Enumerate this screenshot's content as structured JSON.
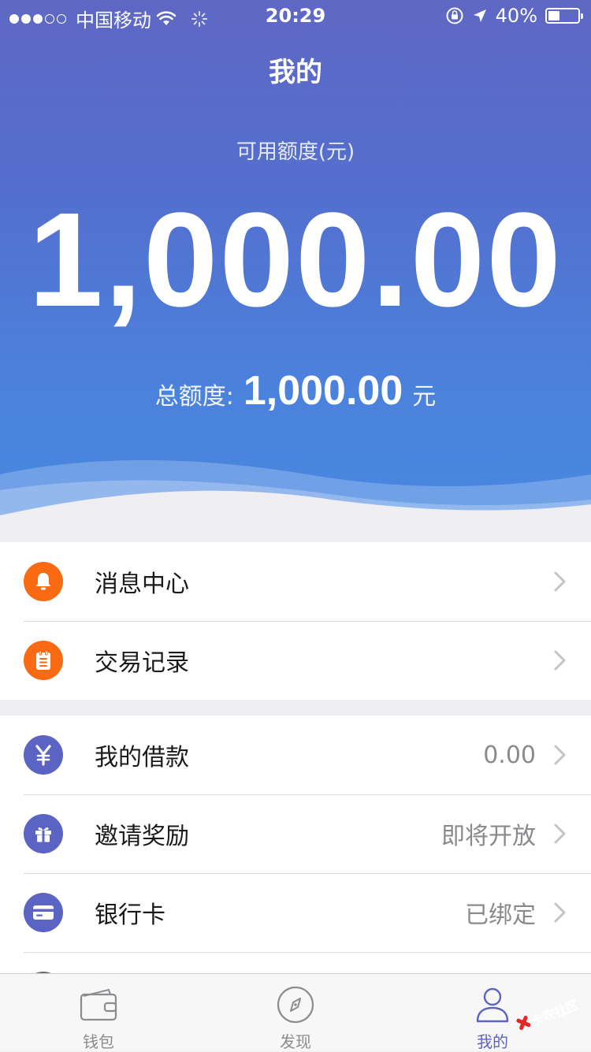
{
  "status_bar": {
    "carrier": "中国移动",
    "time": "20:29",
    "battery_percent": "40%",
    "battery_level": 0.4,
    "signal_bars_filled": 3,
    "signal_bars_total": 5
  },
  "nav": {
    "title": "我的"
  },
  "credit": {
    "available_label": "可用额度(元)",
    "available_amount": "1,000.00",
    "total_label": "总额度:",
    "total_amount": "1,000.00",
    "total_unit": "元"
  },
  "menu": {
    "group1": [
      {
        "label": "消息中心",
        "icon": "bell-icon",
        "value": ""
      },
      {
        "label": "交易记录",
        "icon": "notepad-icon",
        "value": ""
      }
    ],
    "group2": [
      {
        "label": "我的借款",
        "icon": "yuan-icon",
        "value": "0.00"
      },
      {
        "label": "邀请奖励",
        "icon": "gift-icon",
        "value": "即将开放"
      },
      {
        "label": "银行卡",
        "icon": "bank-card-icon",
        "value": "已绑定"
      }
    ]
  },
  "tabbar": {
    "tabs": [
      {
        "label": "钱包",
        "icon": "wallet-icon"
      },
      {
        "label": "发现",
        "icon": "compass-icon"
      },
      {
        "label": "我的",
        "icon": "person-icon"
      }
    ],
    "active_index": 2
  },
  "watermark": {
    "text": "卡农社区"
  },
  "colors": {
    "hero_top": "#5f67c4",
    "hero_bottom": "#4689e2",
    "icon_orange": "#fa6a12",
    "icon_indigo": "#5b63c3",
    "tab_active": "#5b63c3"
  }
}
